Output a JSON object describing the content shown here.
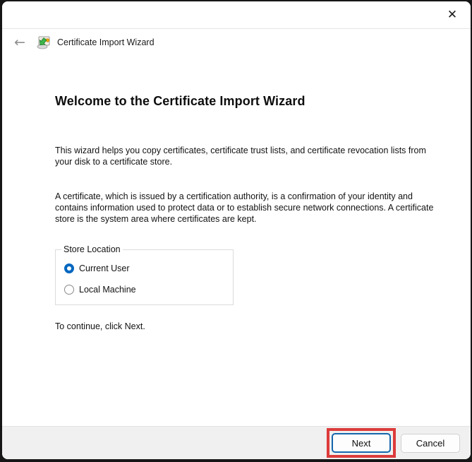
{
  "titlebar": {
    "close_icon": "✕"
  },
  "header": {
    "back_icon": "←",
    "title": "Certificate Import Wizard"
  },
  "main": {
    "heading": "Welcome to the Certificate Import Wizard",
    "paragraph1": "This wizard helps you copy certificates, certificate trust lists, and certificate revocation lists from your disk to a certificate store.",
    "paragraph2": "A certificate, which is issued by a certification authority, is a confirmation of your identity and contains information used to protect data or to establish secure network connections. A certificate store is the system area where certificates are kept.",
    "store_location": {
      "legend": "Store Location",
      "options": [
        {
          "label": "Current User",
          "selected": true
        },
        {
          "label": "Local Machine",
          "selected": false
        }
      ]
    },
    "instruction": "To continue, click Next."
  },
  "footer": {
    "next_label": "Next",
    "cancel_label": "Cancel"
  },
  "colors": {
    "accent_blue": "#0067c0",
    "next_border_blue": "#1466ad",
    "highlight_red": "#dd3b3b",
    "footer_bg": "#f0f0f0",
    "window_bg": "#ffffff"
  }
}
